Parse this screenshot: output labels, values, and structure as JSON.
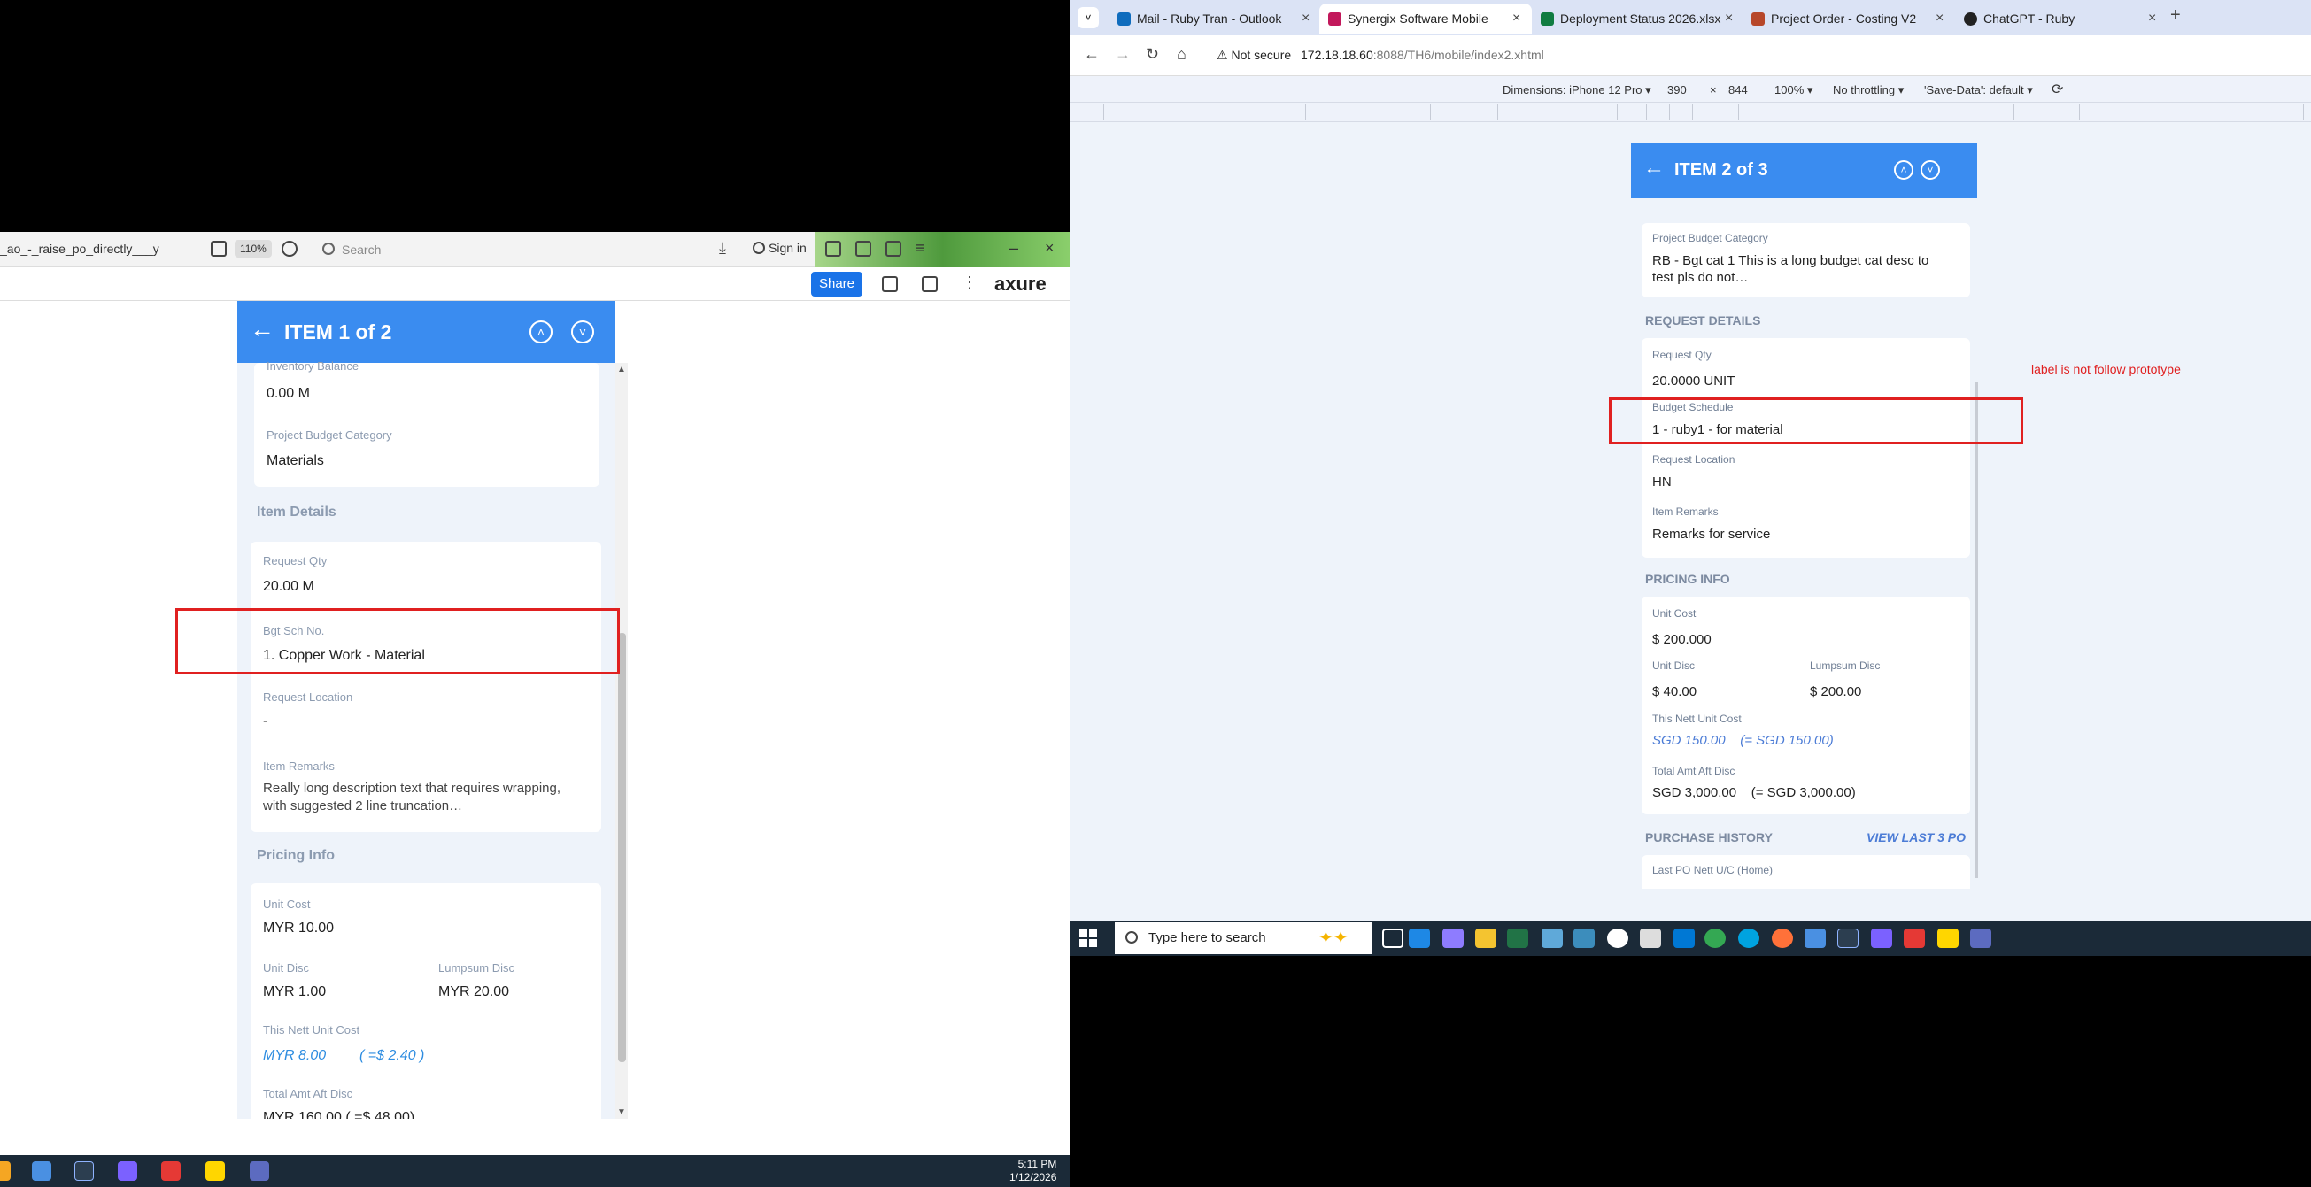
{
  "left_screen": {
    "toolbar": {
      "url": "_ao_-_raise_po_directly___y",
      "zoom": "110%",
      "search_placeholder": "Search",
      "signin": "Sign in"
    },
    "axure_bar": {
      "share": "Share",
      "logo": "axure"
    },
    "phone": {
      "title": "ITEM 1 of 2",
      "fields": {
        "inventory_balance_label": "Inventory Balance",
        "inventory_balance_value": "0.00 M",
        "budget_category_label": "Project Budget Category",
        "budget_category_value": "Materials",
        "item_details_heading": "Item Details",
        "request_qty_label": "Request Qty",
        "request_qty_value": "20.00 M",
        "bgt_sch_label": "Bgt Sch No.",
        "bgt_sch_value": "1. Copper Work - Material",
        "request_location_label": "Request Location",
        "request_location_value": "-",
        "item_remarks_label": "Item Remarks",
        "item_remarks_line1": "Really long description text that requires wrapping,",
        "item_remarks_line2": "with suggested 2 line truncation…",
        "pricing_heading": "Pricing Info",
        "unit_cost_label": "Unit Cost",
        "unit_cost_value": "MYR 10.00",
        "unit_disc_label": "Unit Disc",
        "unit_disc_value": "MYR 1.00",
        "lumpsum_disc_label": "Lumpsum Disc",
        "lumpsum_disc_value": "MYR 20.00",
        "nett_unit_cost_label": "This Nett Unit Cost",
        "nett_unit_cost_value": "MYR 8.00",
        "nett_unit_cost_converted": "( =$ 2.40 )",
        "total_amt_label": "Total Amt Aft Disc",
        "total_amt_value": "MYR 160.00    ( =$ 48.00)"
      }
    },
    "taskbar": {
      "time": "5:11 PM",
      "date": "1/12/2026"
    }
  },
  "right_screen": {
    "tabs": [
      {
        "label": "Mail - Ruby Tran - Outlook",
        "color": "#0f6cbd"
      },
      {
        "label": "Synergix Software Mobile",
        "color": "#c2185b"
      },
      {
        "label": "Deployment Status 2026.xlsx",
        "color": "#107c41"
      },
      {
        "label": "Project Order - Costing V2",
        "color": "#b7472a"
      },
      {
        "label": "ChatGPT - Ruby",
        "color": "#222222"
      }
    ],
    "address": {
      "not_secure": "Not secure",
      "url_host": "172.18.18.60",
      "url_rest": ":8088/TH6/mobile/index2.xhtml"
    },
    "devtools": {
      "dimensions": "Dimensions: iPhone 12 Pro ▾",
      "width": "390",
      "times": "×",
      "height": "844",
      "zoom": "100% ▾",
      "throttling": "No throttling ▾",
      "save_data": "'Save-Data': default ▾"
    },
    "phone": {
      "title": "ITEM 2 of 3",
      "fields": {
        "budget_category_label": "Project Budget Category",
        "budget_category_line1": "RB - Bgt cat 1 This is a long budget cat desc to",
        "budget_category_line2": "test pls do not…",
        "request_details_heading": "REQUEST DETAILS",
        "request_qty_label": "Request Qty",
        "request_qty_value": "20.0000 UNIT",
        "budget_schedule_label": "Budget Schedule",
        "budget_schedule_value": "1 - ruby1 - for material",
        "request_location_label": "Request Location",
        "request_location_value": "HN",
        "item_remarks_label": "Item Remarks",
        "item_remarks_value": "Remarks for service",
        "pricing_heading": "PRICING INFO",
        "unit_cost_label": "Unit Cost",
        "unit_cost_value": "$ 200.000",
        "unit_disc_label": "Unit Disc",
        "unit_disc_value": "$ 40.00",
        "lumpsum_disc_label": "Lumpsum Disc",
        "lumpsum_disc_value": "$ 200.00",
        "nett_unit_cost_label": "This Nett Unit Cost",
        "nett_unit_cost_value": "SGD 150.00    (= SGD 150.00)",
        "total_amt_label": "Total Amt Aft Disc",
        "total_amt_value": "SGD 3,000.00    (= SGD 3,000.00)",
        "purchase_history_heading": "PURCHASE HISTORY",
        "view_last_po": "VIEW LAST 3 PO",
        "last_po_label": "Last PO Nett U/C (Home)"
      }
    },
    "annotation": "label is not follow prototype",
    "taskbar": {
      "search_placeholder": "Type here to search"
    }
  },
  "colors": {
    "header_blue": "#3a8cf0",
    "annotation_red": "#e02020",
    "nett_blue": "#2d8ce0"
  }
}
